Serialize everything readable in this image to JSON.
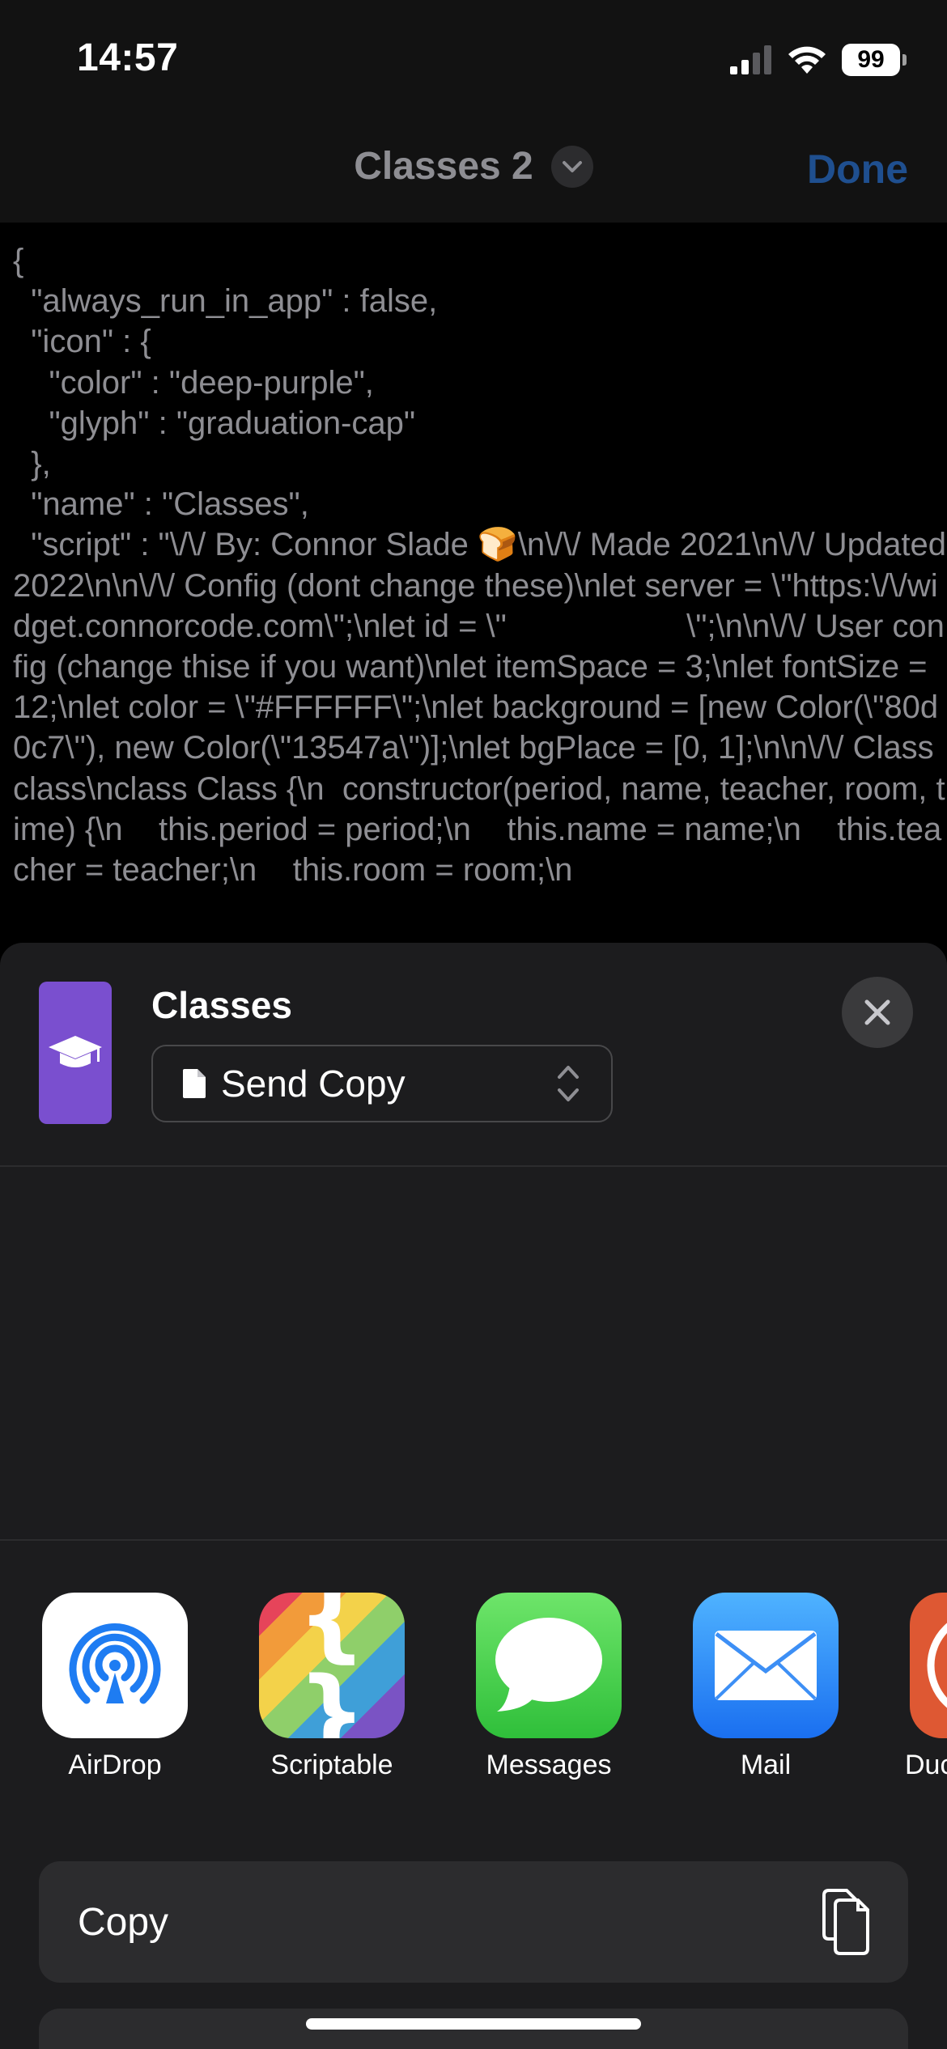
{
  "status_bar": {
    "time": "14:57",
    "battery": "99"
  },
  "nav": {
    "title": "Classes 2",
    "done_label": "Done"
  },
  "code_text": "{\n  \"always_run_in_app\" : false,\n  \"icon\" : {\n    \"color\" : \"deep-purple\",\n    \"glyph\" : \"graduation-cap\"\n  },\n  \"name\" : \"Classes\",\n  \"script\" : \"\\/\\/ By: Connor Slade 🍞\\n\\/\\/ Made 2021\\n\\/\\/ Updated 2022\\n\\n\\/\\/ Config (dont change these)\\nlet server = \\\"https:\\/\\/widget.connorcode.com\\\";\\nlet id = \\\"                    \\\";\\n\\n\\/\\/ User config (change thise if you want)\\nlet itemSpace = 3;\\nlet fontSize = 12;\\nlet color = \\\"#FFFFFF\\\";\\nlet background = [new Color(\\\"80d0c7\\\"), new Color(\\\"13547a\\\")];\\nlet bgPlace = [0, 1];\\n\\n\\/\\/ Class class\\nclass Class {\\n  constructor(period, name, teacher, room, time) {\\n    this.period = period;\\n    this.name = name;\\n    this.teacher = teacher;\\n    this.room = room;\\n",
  "sheet": {
    "title": "Classes",
    "send_option": "Send Copy",
    "app_icon_color": "#7a4fcf"
  },
  "share_apps": [
    {
      "label": "AirDrop",
      "icon": "airdrop-icon"
    },
    {
      "label": "Scriptable",
      "icon": "scriptable-icon"
    },
    {
      "label": "Messages",
      "icon": "messages-icon"
    },
    {
      "label": "Mail",
      "icon": "mail-icon"
    },
    {
      "label": "Duc",
      "icon": "duckduckgo-icon"
    }
  ],
  "actions": [
    {
      "label": "Copy",
      "icon": "copy-icon"
    }
  ],
  "colors": {
    "accent": "#1f4f8f",
    "sheet_bg": "#1c1c1e",
    "code_text": "#8e8e93"
  }
}
